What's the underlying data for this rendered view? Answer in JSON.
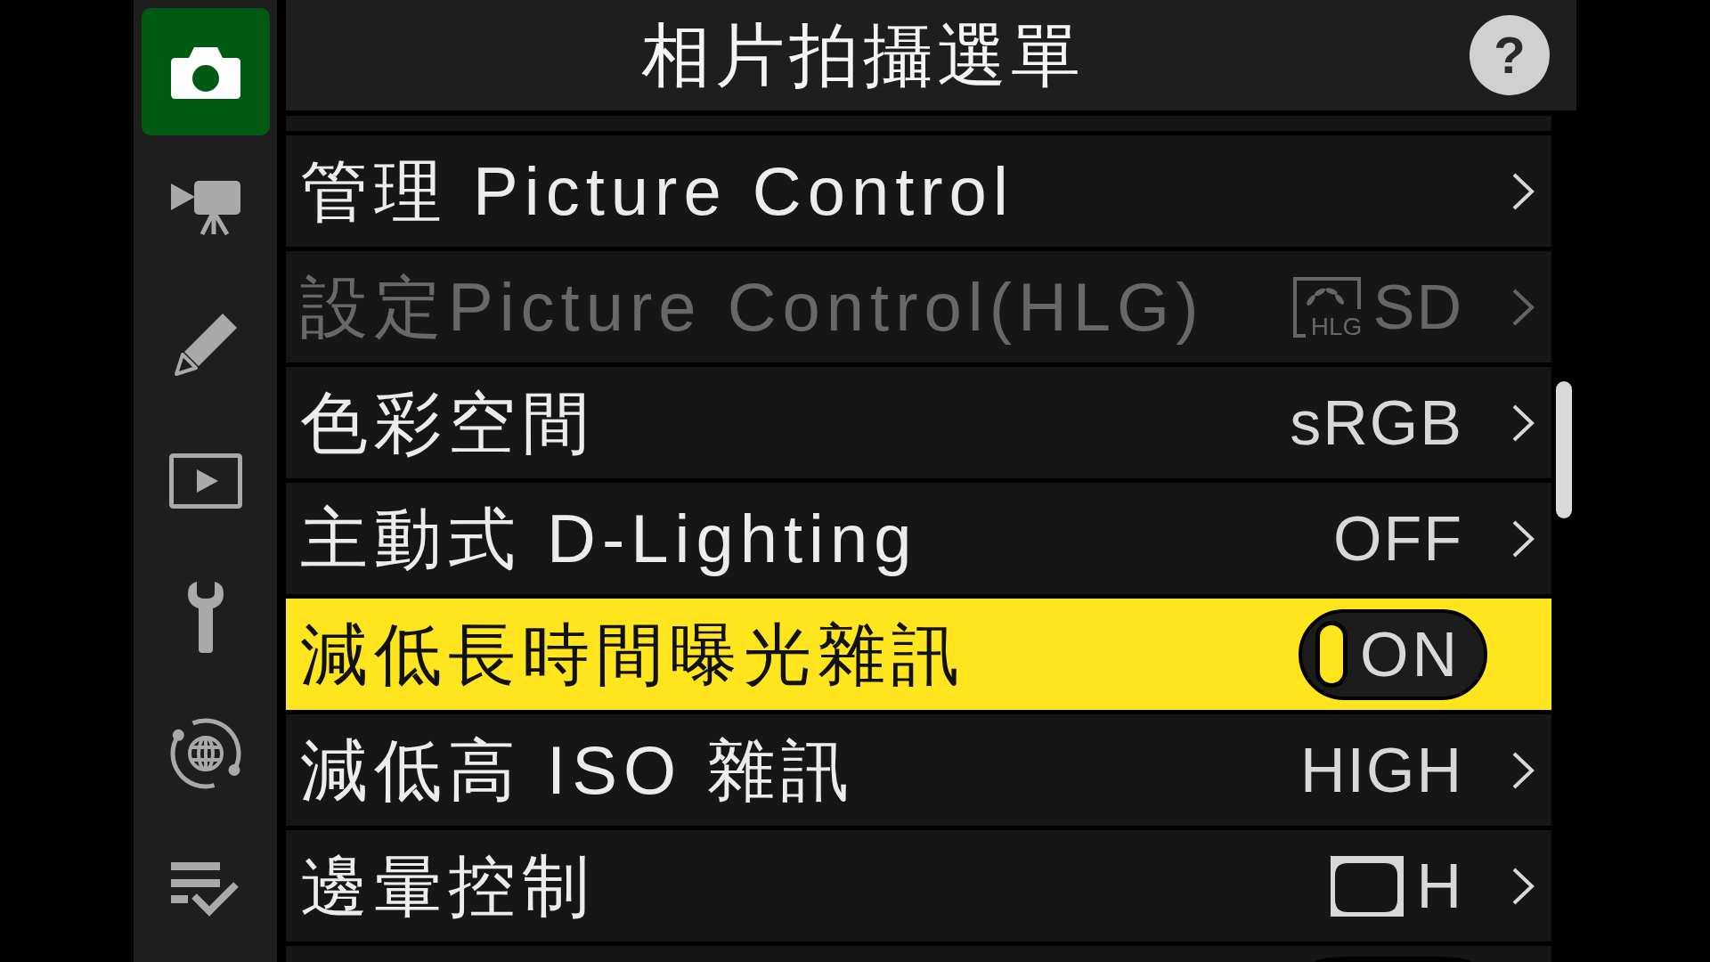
{
  "sidebar": {
    "tabs": [
      {
        "kind": "photo",
        "selected": true
      },
      {
        "kind": "movie",
        "selected": false
      },
      {
        "kind": "custom",
        "selected": false
      },
      {
        "kind": "playback",
        "selected": false
      },
      {
        "kind": "setup",
        "selected": false
      },
      {
        "kind": "network",
        "selected": false
      },
      {
        "kind": "mymenu",
        "selected": false
      }
    ]
  },
  "header": {
    "title": "相片拍攝選單",
    "help": "?"
  },
  "menu": {
    "items": [
      {
        "kind": "submenu",
        "label": "管理 Picture Control",
        "disabled": false,
        "selected": false
      },
      {
        "kind": "submenu",
        "label": "設定Picture Control(HLG)",
        "disabled": true,
        "selected": false,
        "value_icon": {
          "kind": "picture-control",
          "label": "HLG"
        },
        "value": "SD"
      },
      {
        "kind": "submenu",
        "label": "色彩空間",
        "disabled": false,
        "selected": false,
        "value": "sRGB"
      },
      {
        "kind": "submenu",
        "label": "主動式 D-Lighting",
        "disabled": false,
        "selected": false,
        "value": "OFF"
      },
      {
        "kind": "toggle",
        "label": "減低長時間曝光雜訊",
        "disabled": false,
        "selected": true,
        "on": true,
        "value": "ON"
      },
      {
        "kind": "submenu",
        "label": "減低高 ISO 雜訊",
        "disabled": false,
        "selected": false,
        "value": "HIGH"
      },
      {
        "kind": "submenu",
        "label": "邊暈控制",
        "disabled": false,
        "selected": false,
        "value_icon": {
          "kind": "vignette"
        },
        "value": "H"
      }
    ]
  }
}
